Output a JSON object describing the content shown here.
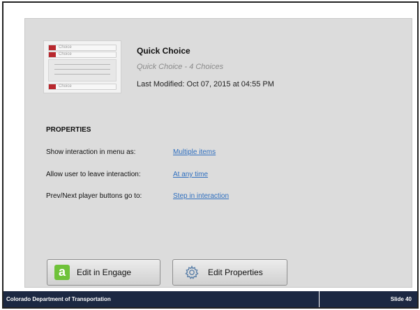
{
  "interaction": {
    "title": "Quick Choice",
    "subtitle": "Quick Choice - 4 Choices",
    "modified": "Last Modified: Oct 07, 2015 at 04:55 PM"
  },
  "thumbnail": {
    "row1": "Choice",
    "row2": "Choice",
    "row3": "Choice",
    "accent_color": "#b8282e"
  },
  "properties": {
    "heading": "PROPERTIES",
    "items": [
      {
        "label": "Show interaction in menu as:",
        "value": "Multiple items"
      },
      {
        "label": "Allow user to leave interaction:",
        "value": "At any time"
      },
      {
        "label": "Prev/Next player buttons go to:",
        "value": "Step in interaction"
      }
    ]
  },
  "buttons": {
    "edit_engage": "Edit in Engage",
    "edit_engage_icon": "engage-app-icon",
    "edit_properties": "Edit Properties",
    "edit_properties_icon": "gear-icon"
  },
  "footer": {
    "org": "Colorado Department of Transportation",
    "slide": "Slide 40",
    "bg_color": "#1c2842"
  }
}
